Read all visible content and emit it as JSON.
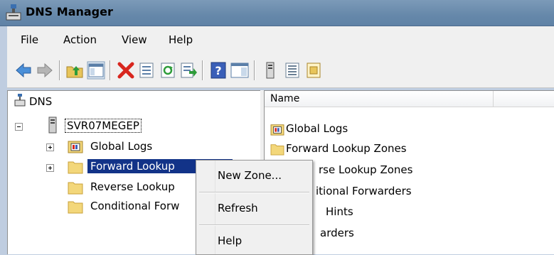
{
  "window": {
    "title": "DNS Manager",
    "icon": "dns-server-icon"
  },
  "menu": [
    "File",
    "Action",
    "View",
    "Help"
  ],
  "toolbar": [
    "back-arrow-icon",
    "forward-arrow-icon",
    "up-folder-icon",
    "show-hide-tree-icon",
    "delete-icon",
    "properties-icon",
    "refresh-icon",
    "export-list-icon",
    "help-icon",
    "show-hide-action-pane-icon",
    "server-icon",
    "list-view-icon",
    "folder-options-icon"
  ],
  "tree": {
    "root": "DNS",
    "server": "SVR07MEGEP",
    "items": [
      {
        "label": "Global Logs",
        "icon": "log-folder-icon"
      },
      {
        "label": "Forward Lookup",
        "icon": "folder-icon",
        "selected": true
      },
      {
        "label": "Reverse Lookup",
        "icon": "folder-icon"
      },
      {
        "label": "Conditional Forw",
        "icon": "folder-icon"
      }
    ]
  },
  "list": {
    "column": "Name",
    "items": [
      "Global Logs",
      "Forward Lookup Zones",
      "rse Lookup Zones",
      "itional Forwarders",
      "Hints",
      "arders"
    ]
  },
  "context_menu": {
    "items": [
      "New Zone...",
      "Refresh",
      "Help"
    ]
  },
  "colors": {
    "selection": "#123388",
    "titlebar": "#6688aa"
  }
}
